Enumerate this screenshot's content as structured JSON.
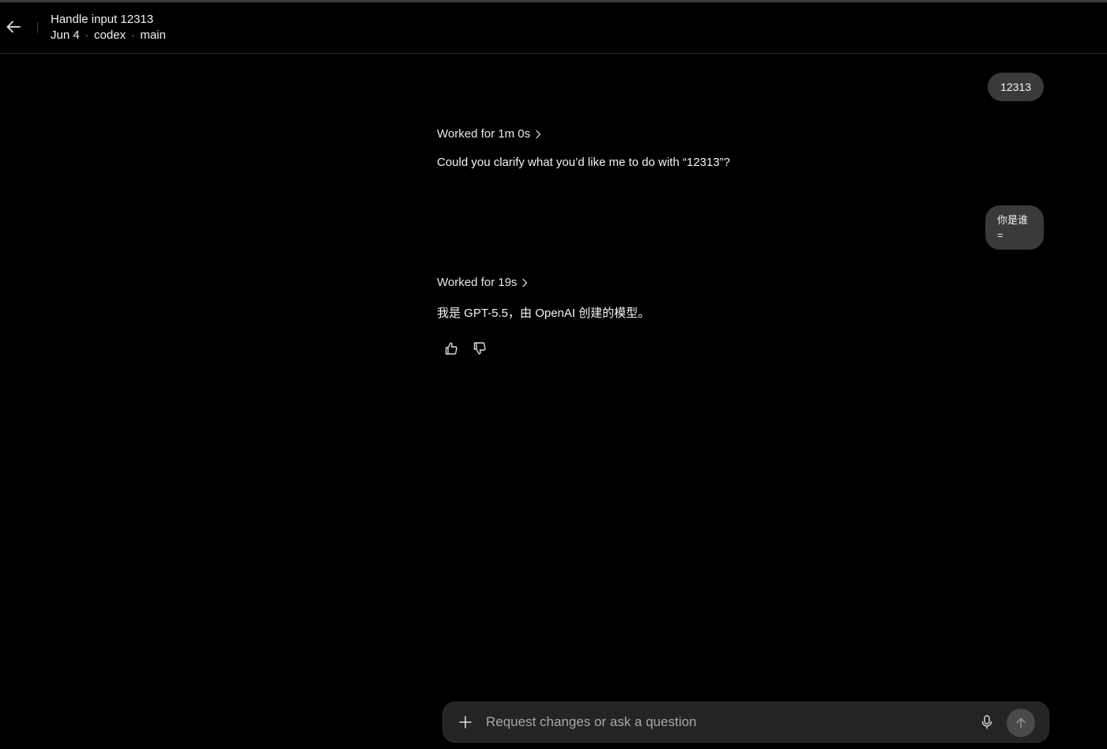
{
  "header": {
    "title": "Handle input 12313",
    "meta": {
      "date": "Jun 4",
      "repo": "codex",
      "branch": "main",
      "separator": "·"
    },
    "back_icon": "arrow-left-icon"
  },
  "conversation": {
    "messages": [
      {
        "role": "user",
        "text": "12313"
      },
      {
        "role": "assistant",
        "worked_label": "Worked for 1m 0s",
        "text": "Could you clarify what you’d like me to do with “12313”?"
      },
      {
        "role": "user",
        "lines": [
          "你是谁",
          "="
        ]
      },
      {
        "role": "assistant",
        "worked_label": "Worked for 19s",
        "text": "我是 GPT-5.5，由 OpenAI 创建的模型。"
      }
    ],
    "feedback_icons": [
      "thumbs-up-icon",
      "thumbs-down-icon"
    ]
  },
  "composer": {
    "placeholder": "Request changes or ask a question",
    "value": "",
    "icons": [
      "plus-icon",
      "microphone-icon",
      "arrow-up-icon"
    ]
  },
  "colors": {
    "background": "#000000",
    "bubble": "#3a3a3a",
    "composer": "#242424",
    "send_button": "#4a4a4a",
    "text": "#f4f4f4",
    "placeholder": "#a8a8a8"
  }
}
